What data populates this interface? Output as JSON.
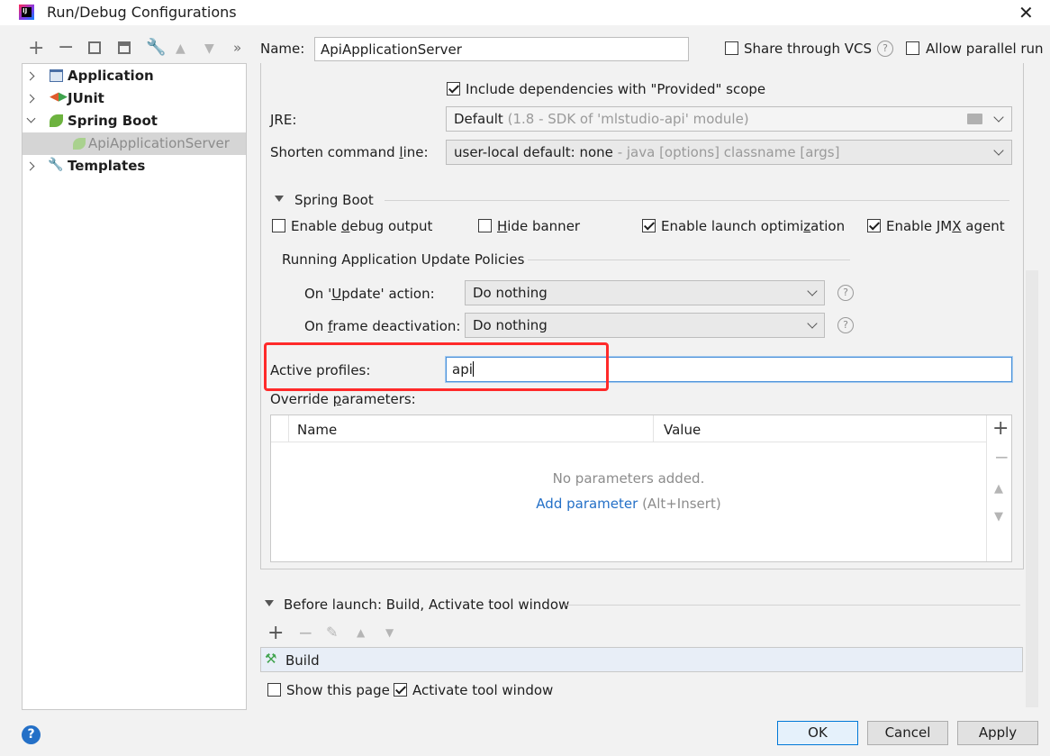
{
  "window": {
    "title": "Run/Debug Configurations"
  },
  "toolbar": {
    "more_label": "»"
  },
  "tree": {
    "items": [
      {
        "label": "Application"
      },
      {
        "label": "JUnit"
      },
      {
        "label": "Spring Boot"
      },
      {
        "label": "ApiApplicationServer"
      },
      {
        "label": "Templates"
      }
    ]
  },
  "header": {
    "name_label": "Name:",
    "name_value": "ApiApplicationServer",
    "share_label": "Share through VCS",
    "parallel_label": "Allow parallel run"
  },
  "config": {
    "include_deps_label": "Include dependencies with \"Provided\" scope",
    "jre_label": "JRE:",
    "jre_value": "Default",
    "jre_hint": "(1.8 - SDK of 'mlstudio-api' module)",
    "shorten_label": "Shorten command line:",
    "shorten_value": "user-local default: none",
    "shorten_hint": "- java [options] classname [args]"
  },
  "spring_boot": {
    "section_label": "Spring Boot",
    "debug_output_label": "Enable debug output",
    "hide_banner_label": "Hide banner",
    "launch_opt_label": "Enable launch optimization",
    "jmx_label": "Enable JMX agent",
    "policies_label": "Running Application Update Policies",
    "update_action_label": "On 'Update' action:",
    "update_action_value": "Do nothing",
    "frame_deact_label": "On frame deactivation:",
    "frame_deact_value": "Do nothing",
    "active_profiles_label": "Active profiles:",
    "active_profiles_value": "api",
    "override_label": "Override parameters:",
    "table": {
      "col_name": "Name",
      "col_value": "Value",
      "empty_text": "No parameters added.",
      "add_link": "Add parameter",
      "add_shortcut": "(Alt+Insert)"
    }
  },
  "before_launch": {
    "label": "Before launch: Build, Activate tool window",
    "items": [
      {
        "label": "Build"
      }
    ],
    "show_page_label": "Show this page",
    "activate_label": "Activate tool window"
  },
  "buttons": {
    "ok": "OK",
    "cancel": "Cancel",
    "apply": "Apply"
  },
  "colors": {
    "highlight": "#ff2a2a",
    "link": "#2470c7",
    "focus": "#4a90d9"
  }
}
